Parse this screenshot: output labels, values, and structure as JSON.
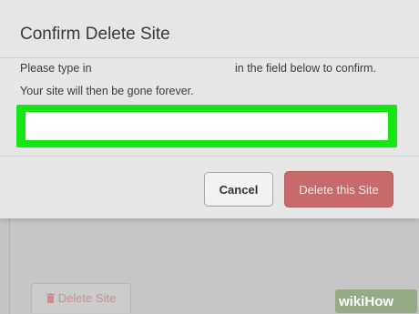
{
  "modal": {
    "title": "Confirm Delete Site",
    "instruction_part1": "Please type in",
    "instruction_part2": "in the field below to confirm.",
    "instruction_line2": "Your site will then be gone forever.",
    "confirm_input_value": "",
    "cancel_label": "Cancel",
    "delete_label": "Delete this Site"
  },
  "background": {
    "delete_site_label": "Delete Site"
  },
  "colors": {
    "highlight": "#16e616",
    "delete_button": "#c86a6a"
  },
  "watermark": {
    "wiki": "wiki",
    "how": "How"
  }
}
